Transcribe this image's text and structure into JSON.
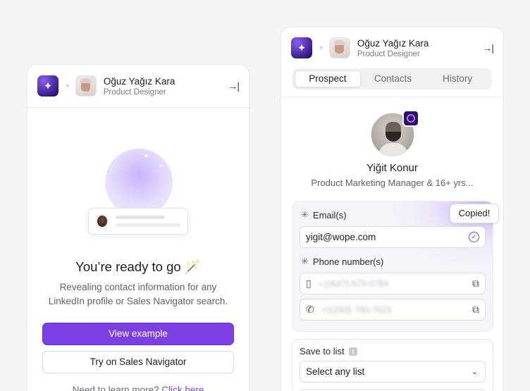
{
  "left": {
    "header": {
      "name": "Oğuz Yağız Kara",
      "role": "Product Designer",
      "separator": "×",
      "collapse_icon": "→|"
    },
    "heading": "You’re ready to go 🪄",
    "description": "Revealing contact information for any LinkedIn profile or Sales Navigator search.",
    "primary_button": "View example",
    "secondary_button": "Try on Sales Navigator",
    "learn_prefix": "Need to learn more?",
    "learn_link": "Click here"
  },
  "right": {
    "header": {
      "name": "Oğuz Yağız Kara",
      "role": "Product Designer",
      "separator": "×",
      "collapse_icon": "→|"
    },
    "tabs": [
      {
        "label": "Prospect",
        "active": true
      },
      {
        "label": "Contacts",
        "active": false
      },
      {
        "label": "History",
        "active": false
      }
    ],
    "profile": {
      "name": "Yiğit Konur",
      "title": "Product Marketing Manager & 16+ yrs..."
    },
    "emails": {
      "label": "Email(s)",
      "value": "yigit@wope.com",
      "tooltip": "Copied!"
    },
    "phones": {
      "label": "Phone number(s)",
      "items": [
        {
          "type": "mobile",
          "value": "+1(647) 673-0784"
        },
        {
          "type": "landline",
          "value": "+1(293) 790-7623"
        }
      ]
    },
    "save": {
      "label": "Save to list",
      "placeholder": "Select any list"
    }
  },
  "colors": {
    "accent": "#7b3fe4",
    "background": "#f4f4f6"
  }
}
